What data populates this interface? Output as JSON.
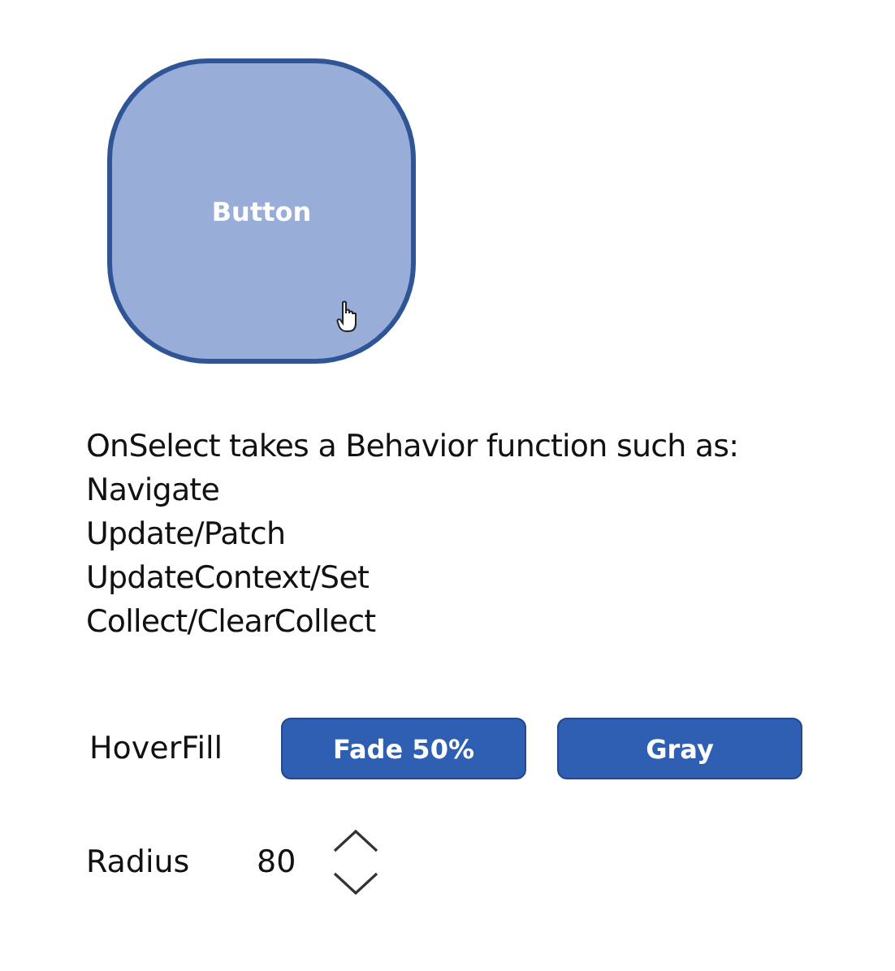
{
  "main_button": {
    "label": "Button"
  },
  "description": [
    "OnSelect takes a Behavior function such as:",
    "Navigate",
    "Update/Patch",
    "UpdateContext/Set",
    "Collect/ClearCollect"
  ],
  "hover_fill": {
    "label": "HoverFill",
    "buttons": [
      "Fade 50%",
      "Gray"
    ]
  },
  "radius": {
    "label": "Radius",
    "value": "80"
  }
}
